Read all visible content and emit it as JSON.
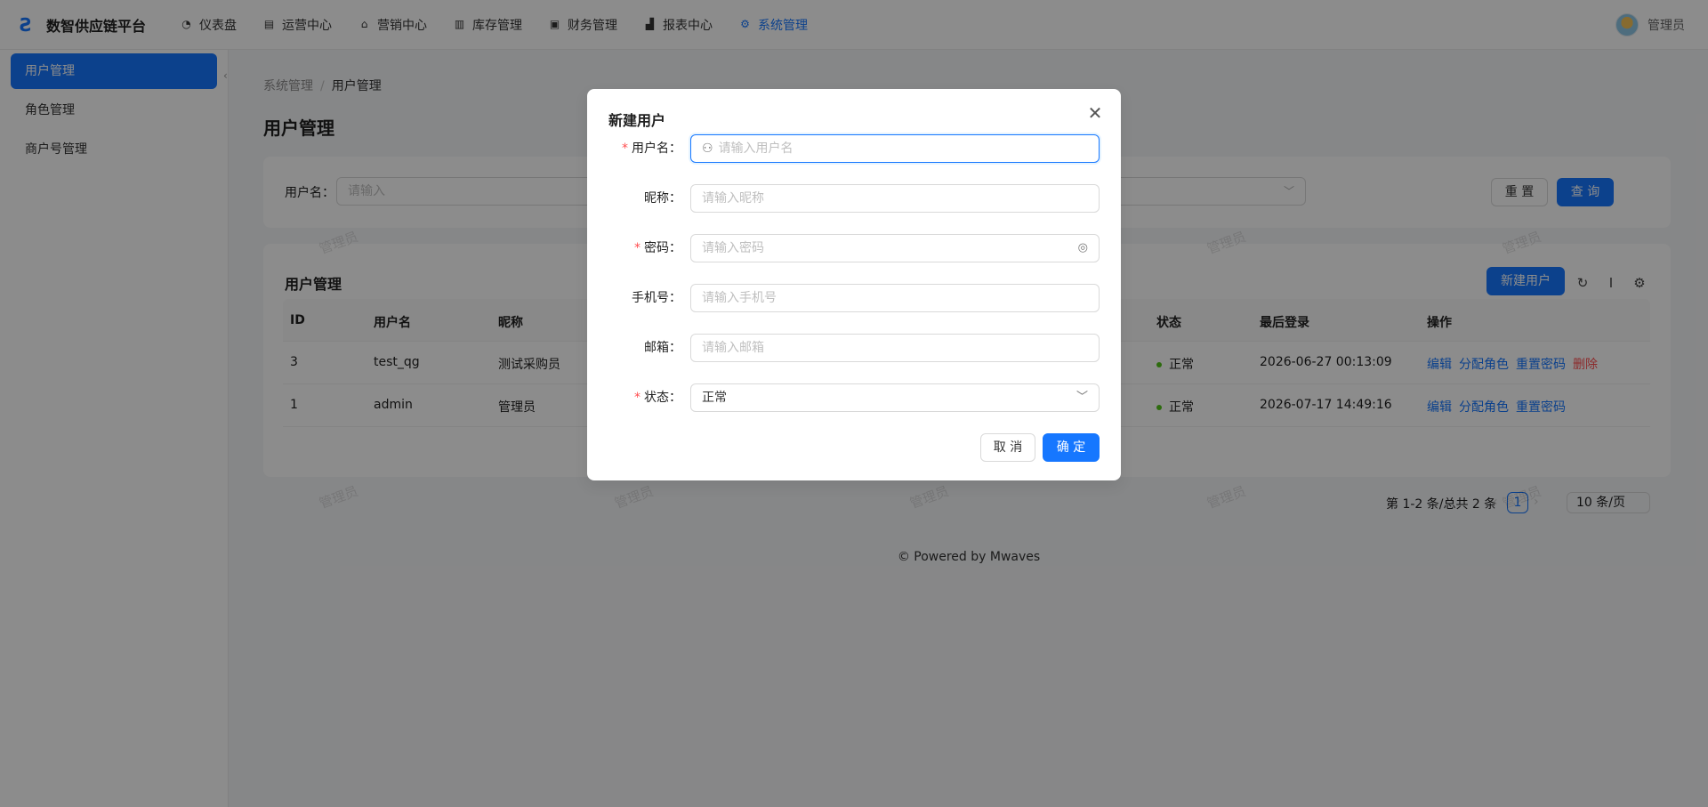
{
  "app": {
    "title": "数智供应链平台",
    "logo_icon": "logo-icon"
  },
  "topnav": [
    {
      "label": "仪表盘",
      "icon": "dashboard-icon",
      "glyph": "◔"
    },
    {
      "label": "运营中心",
      "icon": "store-icon",
      "glyph": "▤"
    },
    {
      "label": "营销中心",
      "icon": "gift-icon",
      "glyph": "⌂"
    },
    {
      "label": "库存管理",
      "icon": "inventory-icon",
      "glyph": "▥"
    },
    {
      "label": "财务管理",
      "icon": "finance-icon",
      "glyph": "▣"
    },
    {
      "label": "报表中心",
      "icon": "chart-icon",
      "glyph": "▟"
    },
    {
      "label": "系统管理",
      "icon": "settings-icon",
      "glyph": "⚙"
    }
  ],
  "user": {
    "name": "管理员"
  },
  "sidebar": {
    "items": [
      {
        "label": "用户管理"
      },
      {
        "label": "角色管理"
      },
      {
        "label": "商户号管理"
      }
    ]
  },
  "breadcrumb": {
    "parent": "系统管理",
    "separator": "/",
    "current": "用户管理"
  },
  "page_title": "用户管理",
  "search": {
    "label": "用户名：",
    "placeholder": "请输入",
    "reset": "重 置",
    "query": "查 询"
  },
  "table": {
    "title": "用户管理",
    "new_button": "新建用户",
    "columns": [
      "ID",
      "用户名",
      "昵称",
      "状态",
      "最后登录",
      "操作"
    ],
    "rows": [
      {
        "id": "3",
        "username": "test_qg",
        "nickname": "测试采购员",
        "status": "正常",
        "last_login": "2026-06-27 00:13:09",
        "actions": [
          "编辑",
          "分配角色",
          "重置密码"
        ],
        "danger_action": "删除"
      },
      {
        "id": "1",
        "username": "admin",
        "nickname": "管理员",
        "status": "正常",
        "last_login": "2026-07-17 14:49:16",
        "actions": [
          "编辑",
          "分配角色",
          "重置密码"
        ],
        "danger_action": ""
      }
    ],
    "pagination": {
      "summary": "第 1-2 条/总共 2 条",
      "current": "1",
      "page_size": "10 条/页"
    }
  },
  "footer": "Powered by Mwaves",
  "watermark": "管理员",
  "modal": {
    "title": "新建用户",
    "fields": [
      {
        "label": "用户名",
        "required": true,
        "placeholder": "请输入用户名"
      },
      {
        "label": "昵称",
        "required": false,
        "placeholder": "请输入昵称"
      },
      {
        "label": "密码",
        "required": true,
        "placeholder": "请输入密码"
      },
      {
        "label": "手机号",
        "required": false,
        "placeholder": "请输入手机号"
      },
      {
        "label": "邮箱",
        "required": false,
        "placeholder": "请输入邮箱"
      },
      {
        "label": "状态",
        "required": true,
        "value": "正常"
      }
    ],
    "cancel": "取 消",
    "ok": "确 定"
  },
  "colors": {
    "primary": "#1677ff",
    "danger": "#ff4d4f",
    "success": "#52c41a"
  }
}
